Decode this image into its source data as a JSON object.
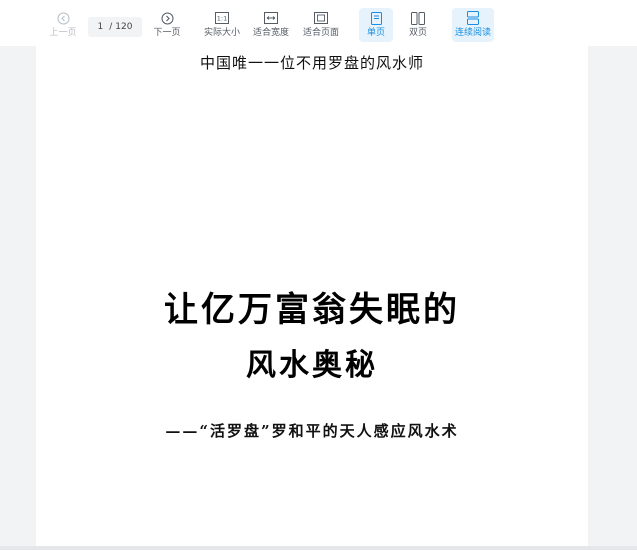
{
  "toolbar": {
    "prev_label": "上一页",
    "current_page": "1",
    "total_pages": "120",
    "next_label": "下一页",
    "actual_size_label": "实际大小",
    "fit_width_label": "适合宽度",
    "fit_page_label": "适合页面",
    "single_page_label": "单页",
    "double_page_label": "双页",
    "continuous_label": "连续阅读",
    "accent_color": "#1a8ee0"
  },
  "document": {
    "header": "中国唯一一位不用罗盘的风水师",
    "title_line1": "让亿万富翁失眠的",
    "title_line2": "风水奥秘",
    "subtitle": "——“活罗盘”罗和平的天人感应风水术"
  }
}
